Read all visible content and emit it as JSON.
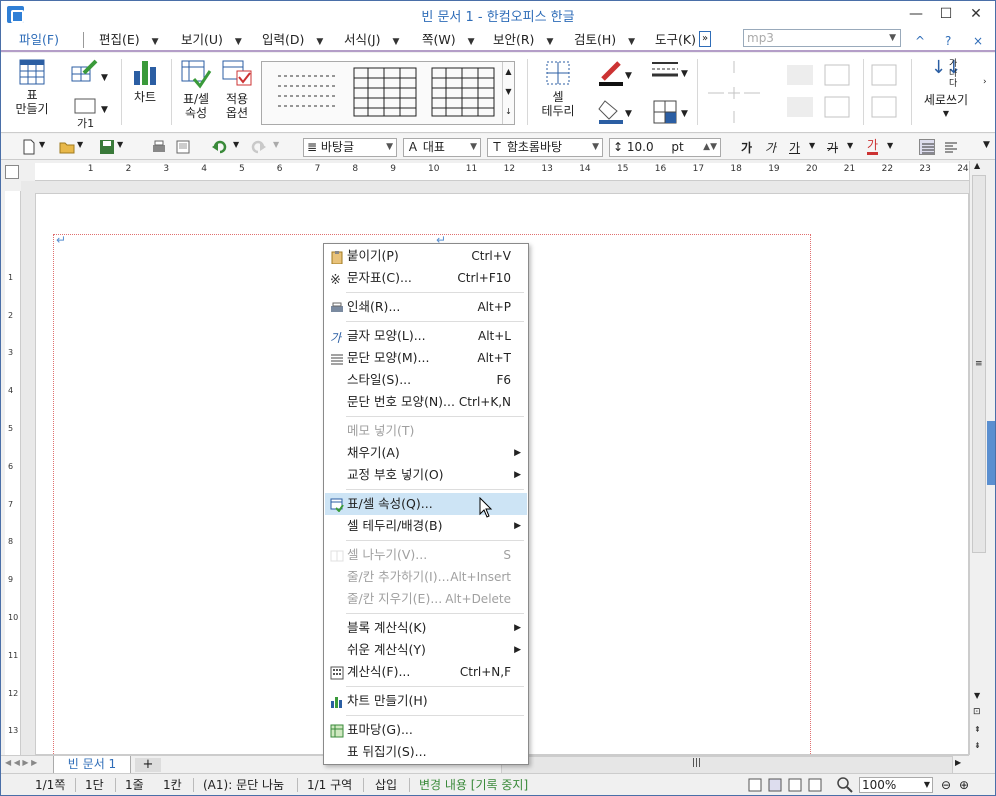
{
  "window": {
    "title": "빈 문서 1 - 한컴오피스 한글",
    "minimize": "—",
    "maximize": "☐",
    "close": "✕"
  },
  "menubar": {
    "items": [
      "파일(F)",
      "편집(E)",
      "보기(U)",
      "입력(D)",
      "서식(J)",
      "쪽(W)",
      "보안(R)",
      "검토(H)",
      "도구(K)"
    ],
    "search_value": "mp3",
    "extra": [
      "^",
      "?",
      "×"
    ]
  },
  "ribbon": {
    "table_make": "표\n만들기",
    "chart": "차트",
    "table_cell_props": "표/셀\n속성",
    "apply_options": "적용\n옵션",
    "cell_border": "셀\n테두리",
    "vertical_writing": "세로쓰기",
    "shape_label": "가1",
    "vertical_sample": "가\n나\n다"
  },
  "toolbar": {
    "style": "바탕글",
    "lang": "대표",
    "font": "함초롬바탕",
    "size": "10.0",
    "unit": "pt",
    "bold": "가",
    "italic": "가",
    "underline": "가",
    "strike": "가",
    "color": "가"
  },
  "ruler": {
    "h_ticks": [
      "1",
      "2",
      "3",
      "4",
      "5",
      "6",
      "7",
      "8",
      "9",
      "10",
      "11",
      "12",
      "13",
      "14",
      "15",
      "16",
      "17",
      "18",
      "19",
      "20",
      "21",
      "22",
      "23",
      "24"
    ],
    "v_ticks": [
      "1",
      "2",
      "3",
      "4",
      "5",
      "6",
      "7",
      "8",
      "9",
      "10",
      "11",
      "12",
      "13"
    ]
  },
  "context_menu": {
    "items": [
      {
        "label": "붙이기(P)",
        "shortcut": "Ctrl+V",
        "icon": "paste-icon",
        "disabled": false,
        "submenu": false
      },
      {
        "label": "문자표(C)...",
        "shortcut": "Ctrl+F10",
        "icon": "symbol-icon",
        "disabled": false,
        "submenu": false
      },
      {
        "sep": true
      },
      {
        "label": "인쇄(R)...",
        "shortcut": "Alt+P",
        "icon": "print-icon",
        "disabled": false,
        "submenu": false
      },
      {
        "sep": true
      },
      {
        "label": "글자 모양(L)...",
        "shortcut": "Alt+L",
        "icon": "char-shape-icon",
        "disabled": false,
        "submenu": false
      },
      {
        "label": "문단 모양(M)...",
        "shortcut": "Alt+T",
        "icon": "para-shape-icon",
        "disabled": false,
        "submenu": false
      },
      {
        "label": "스타일(S)...",
        "shortcut": "F6",
        "icon": "",
        "disabled": false,
        "submenu": false
      },
      {
        "label": "문단 번호 모양(N)...",
        "shortcut": "Ctrl+K,N",
        "icon": "",
        "disabled": false,
        "submenu": false
      },
      {
        "sep": true
      },
      {
        "label": "메모 넣기(T)",
        "shortcut": "",
        "icon": "",
        "disabled": true,
        "submenu": false
      },
      {
        "label": "채우기(A)",
        "shortcut": "",
        "icon": "",
        "disabled": false,
        "submenu": true
      },
      {
        "label": "교정 부호 넣기(O)",
        "shortcut": "",
        "icon": "",
        "disabled": false,
        "submenu": true
      },
      {
        "sep": true
      },
      {
        "label": "표/셀 속성(Q)...",
        "shortcut": "",
        "icon": "table-props-icon",
        "disabled": false,
        "submenu": false,
        "highlight": true
      },
      {
        "label": "셀 테두리/배경(B)",
        "shortcut": "",
        "icon": "",
        "disabled": false,
        "submenu": true
      },
      {
        "sep": true
      },
      {
        "label": "셀 나누기(V)...",
        "shortcut": "S",
        "icon": "split-cell-icon",
        "disabled": true,
        "submenu": false
      },
      {
        "label": "줄/칸 추가하기(I)...",
        "shortcut": "Alt+Insert",
        "icon": "",
        "disabled": true,
        "submenu": false
      },
      {
        "label": "줄/칸 지우기(E)...",
        "shortcut": "Alt+Delete",
        "icon": "",
        "disabled": true,
        "submenu": false
      },
      {
        "sep": true
      },
      {
        "label": "블록 계산식(K)",
        "shortcut": "",
        "icon": "",
        "disabled": false,
        "submenu": true
      },
      {
        "label": "쉬운 계산식(Y)",
        "shortcut": "",
        "icon": "",
        "disabled": false,
        "submenu": true
      },
      {
        "label": "계산식(F)...",
        "shortcut": "Ctrl+N,F",
        "icon": "calculator-icon",
        "disabled": false,
        "submenu": false
      },
      {
        "sep": true
      },
      {
        "label": "차트 만들기(H)",
        "shortcut": "",
        "icon": "chart-icon",
        "disabled": false,
        "submenu": false
      },
      {
        "sep": true
      },
      {
        "label": "표마당(G)...",
        "shortcut": "",
        "icon": "table-gallery-icon",
        "disabled": false,
        "submenu": false
      },
      {
        "label": "표 뒤집기(S)...",
        "shortcut": "",
        "icon": "",
        "disabled": false,
        "submenu": false
      }
    ]
  },
  "tabs": {
    "doc": "빈 문서 1",
    "add": "+"
  },
  "status": {
    "page": "1/1쪽",
    "col": "1단",
    "line": "1줄",
    "cell": "1칸",
    "cell_ref": "(A1): 문단 나눔",
    "section": "1/1 구역",
    "mode": "삽입",
    "track": "변경 내용 [기록 중지]",
    "zoom": "100%"
  },
  "colors": {
    "accent": "#2f6db8",
    "track_green": "#3a8a3a",
    "highlight": "#cde4f5",
    "border_red": "#e07070"
  }
}
